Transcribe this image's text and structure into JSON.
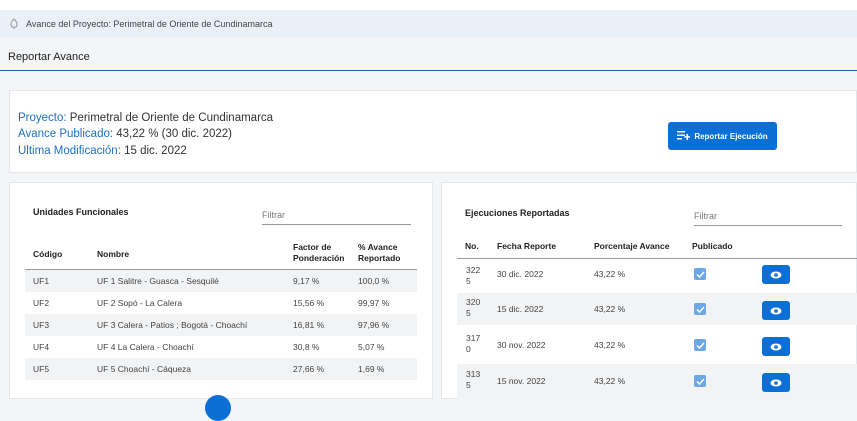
{
  "breadcrumb": {
    "text": "Avance del Proyecto: Perimetral de Oriente de Cundinamarca"
  },
  "section_title": "Reportar Avance",
  "project": {
    "proyecto_label": "Proyecto:",
    "proyecto_value": "Perimetral de Oriente de Cundinamarca",
    "avance_label": "Avance Publicado:",
    "avance_value": "43,22 % (30 dic. 2022)",
    "modificacion_label": "Ultima Modificación:",
    "modificacion_value": "15 dic. 2022"
  },
  "report_button": {
    "label": "Reportar Ejecución"
  },
  "unidades": {
    "title": "Unidades Funcionales",
    "filter_placeholder": "Filtrar",
    "headers": {
      "codigo": "Código",
      "nombre": "Nombre",
      "factor_1": "Factor de",
      "factor_2": "Ponderación",
      "avance_1": "% Avance",
      "avance_2": "Reportado"
    },
    "rows": [
      {
        "codigo": "UF1",
        "nombre": "UF 1 Salitre - Guasca - Sesquilé",
        "factor": "9,17 %",
        "avance": "100,0 %"
      },
      {
        "codigo": "UF2",
        "nombre": "UF 2 Sopó - La Calera",
        "factor": "15,56 %",
        "avance": "99,97 %"
      },
      {
        "codigo": "UF3",
        "nombre": "UF 3 Calera - Patios ; Bogotá - Choachí",
        "factor": "16,81 %",
        "avance": "97,96 %"
      },
      {
        "codigo": "UF4",
        "nombre": "UF 4 La Calera - Choachí",
        "factor": "30,8 %",
        "avance": "5,07 %"
      },
      {
        "codigo": "UF5",
        "nombre": "UF 5 Choachí - Cáqueza",
        "factor": "27,66 %",
        "avance": "1,69 %"
      }
    ]
  },
  "ejecuciones": {
    "title": "Ejecuciones Reportadas",
    "filter_placeholder": "Filtrar",
    "headers": {
      "no": "No.",
      "fecha": "Fecha Reporte",
      "porcentaje": "Porcentaje Avance",
      "publicado": "Publicado"
    },
    "rows": [
      {
        "no_1": "322",
        "no_2": "5",
        "fecha": "30 dic. 2022",
        "porcentaje": "43,22 %",
        "publicado": true
      },
      {
        "no_1": "320",
        "no_2": "5",
        "fecha": "15 dic. 2022",
        "porcentaje": "43,22 %",
        "publicado": true
      },
      {
        "no_1": "317",
        "no_2": "0",
        "fecha": "30 nov. 2022",
        "porcentaje": "43,22 %",
        "publicado": true
      },
      {
        "no_1": "313",
        "no_2": "5",
        "fecha": "15 nov. 2022",
        "porcentaje": "43,22 %",
        "publicado": true
      }
    ]
  },
  "colors": {
    "accent": "#0b6fd6",
    "link": "#1f6fc2",
    "check": "#6ea7e6"
  }
}
